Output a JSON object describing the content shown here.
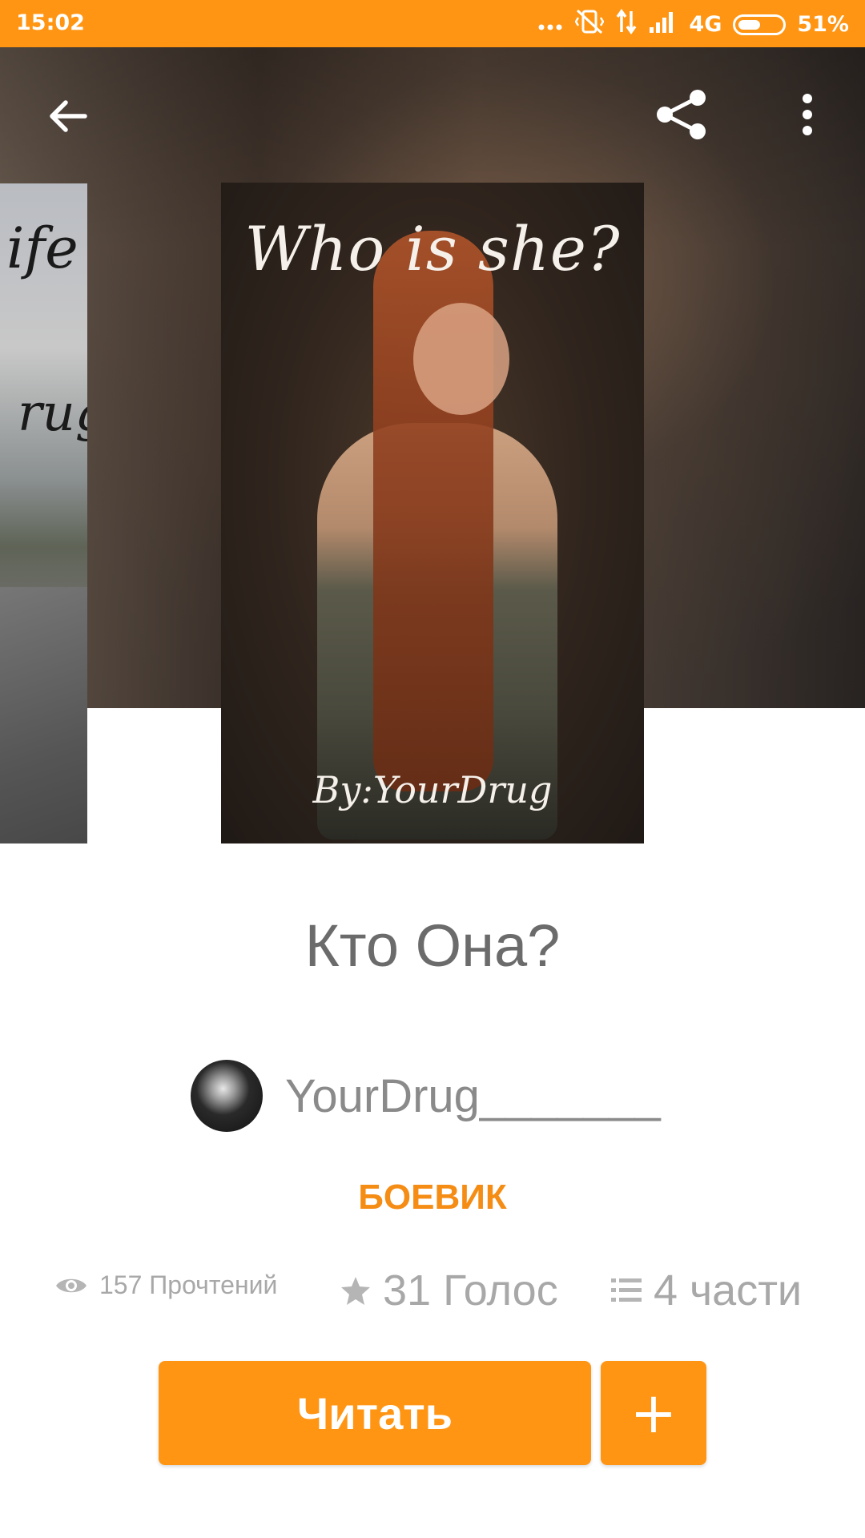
{
  "status_bar": {
    "time": "15:02",
    "network": "4G",
    "battery_percent": "51%",
    "battery_level": 0.51,
    "icons": [
      "more-dots-icon",
      "vibrate-off-icon",
      "data-arrows-icon",
      "signal-icon",
      "battery-icon"
    ]
  },
  "colors": {
    "accent": "#ff9512",
    "genre": "#f58c14",
    "title_text": "#6b6b6b",
    "muted_text": "#a8a8a8"
  },
  "toolbar": {
    "back_icon": "arrow-back-icon",
    "share_icon": "share-icon",
    "menu_icon": "more-vertical-icon"
  },
  "covers": {
    "main": {
      "title": "Who is she?",
      "byline": "By:YourDrug"
    },
    "left_peek": {
      "title_fragment": "ife",
      "author_fragment": "rug"
    }
  },
  "book": {
    "title": "Кто Она?",
    "author": "YourDrug_______",
    "genre": "БОЕВИК"
  },
  "stats": {
    "reads": "157 Прочтений",
    "votes": "31 Голос",
    "parts": "4 части"
  },
  "actions": {
    "read_label": "Читать",
    "add_label": "+"
  }
}
